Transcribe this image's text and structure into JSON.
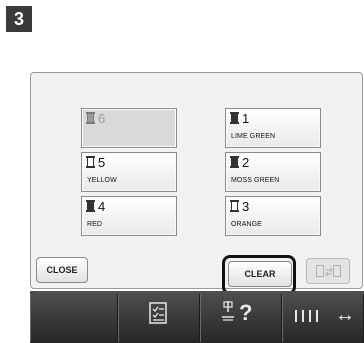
{
  "step": {
    "number": "3"
  },
  "spools": [
    {
      "num": "6",
      "name": "",
      "icon": "spool-icon",
      "fill": "mid",
      "empty": true
    },
    {
      "num": "1",
      "name": "LIME GREEN",
      "icon": "spool-icon",
      "fill": "dark",
      "empty": false
    },
    {
      "num": "5",
      "name": "YELLOW",
      "icon": "spool-icon",
      "fill": "light",
      "empty": false
    },
    {
      "num": "2",
      "name": "MOSS GREEN",
      "icon": "spool-icon",
      "fill": "dark",
      "empty": false
    },
    {
      "num": "4",
      "name": "RED",
      "icon": "spool-icon",
      "fill": "dark",
      "empty": false
    },
    {
      "num": "3",
      "name": "ORANGE",
      "icon": "spool-icon",
      "fill": "light",
      "empty": false
    }
  ],
  "buttons": {
    "close_label": "CLOSE",
    "clear_label": "CLEAR"
  },
  "bottom_bar": {
    "help_label": "?",
    "arrow_label": "↔"
  },
  "icons": {
    "checklist": "checklist-icon",
    "help": "help-icon",
    "swap": "swap-icon",
    "thread-arrow": "thread-arrow-icon"
  }
}
